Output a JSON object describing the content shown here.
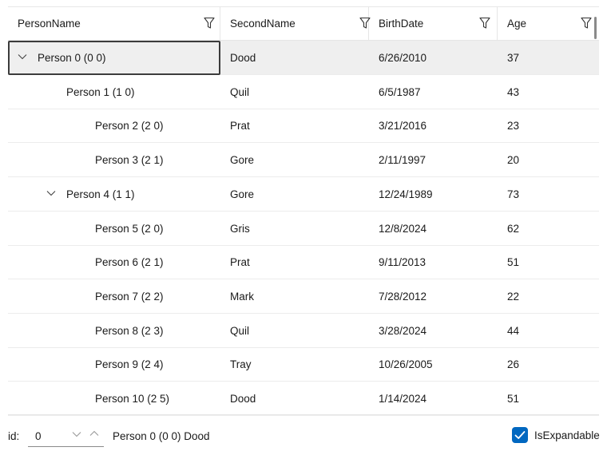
{
  "columns": [
    {
      "label": "PersonName"
    },
    {
      "label": "SecondName"
    },
    {
      "label": "BirthDate"
    },
    {
      "label": "Age"
    }
  ],
  "rows": [
    {
      "name": "Person 0 (0 0)",
      "second": "Dood",
      "birth": "6/26/2010",
      "age": "37",
      "level": 0,
      "expander": "expanded",
      "selected": true
    },
    {
      "name": "Person 1 (1 0)",
      "second": "Quil",
      "birth": "6/5/1987",
      "age": "43",
      "level": 1,
      "expander": "none",
      "selected": false
    },
    {
      "name": "Person 2 (2 0)",
      "second": "Prat",
      "birth": "3/21/2016",
      "age": "23",
      "level": 2,
      "expander": "none",
      "selected": false
    },
    {
      "name": "Person 3 (2 1)",
      "second": "Gore",
      "birth": "2/11/1997",
      "age": "20",
      "level": 2,
      "expander": "none",
      "selected": false
    },
    {
      "name": "Person 4 (1 1)",
      "second": "Gore",
      "birth": "12/24/1989",
      "age": "73",
      "level": 1,
      "expander": "expanded",
      "selected": false
    },
    {
      "name": "Person 5 (2 0)",
      "second": "Gris",
      "birth": "12/8/2024",
      "age": "62",
      "level": 2,
      "expander": "none",
      "selected": false
    },
    {
      "name": "Person 6 (2 1)",
      "second": "Prat",
      "birth": "9/11/2013",
      "age": "51",
      "level": 2,
      "expander": "none",
      "selected": false
    },
    {
      "name": "Person 7 (2 2)",
      "second": "Mark",
      "birth": "7/28/2012",
      "age": "22",
      "level": 2,
      "expander": "none",
      "selected": false
    },
    {
      "name": "Person 8 (2 3)",
      "second": "Quil",
      "birth": "3/28/2024",
      "age": "44",
      "level": 2,
      "expander": "none",
      "selected": false
    },
    {
      "name": "Person 9 (2 4)",
      "second": "Tray",
      "birth": "10/26/2005",
      "age": "26",
      "level": 2,
      "expander": "none",
      "selected": false
    },
    {
      "name": "Person 10 (2 5)",
      "second": "Dood",
      "birth": "1/14/2024",
      "age": "51",
      "level": 2,
      "expander": "none",
      "selected": false
    }
  ],
  "footer": {
    "id_label": "id:",
    "id_value": "0",
    "selection_text": "Person 0 (0 0) Dood",
    "checkbox_label": "IsExpandable",
    "checkbox_checked": true
  },
  "colors": {
    "accent": "#0067c0",
    "selected_row": "#efefef",
    "grid_line": "#e6e6e6"
  },
  "icons": {
    "filter": "filter-icon",
    "expander": "chevron-down-icon",
    "stepper_down": "chevron-down-icon",
    "stepper_up": "chevron-up-icon",
    "check": "checkmark-icon"
  }
}
